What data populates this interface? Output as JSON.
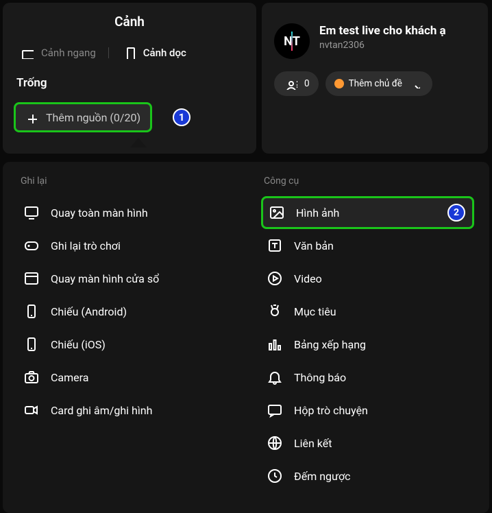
{
  "leftPanel": {
    "title": "Cảnh",
    "tabs": {
      "horizontal": "Cảnh ngang",
      "vertical": "Cảnh dọc"
    },
    "emptyLabel": "Trống",
    "addSource": "Thêm nguồn (0/20)",
    "calloutNumber": "1"
  },
  "rightPanel": {
    "avatarText": "NT",
    "title": "Em test live cho khách ạ",
    "username": "nvtan2306",
    "viewerCount": "0",
    "addTopic": "Thêm chủ đề"
  },
  "dropdown": {
    "col1Title": "Ghi lại",
    "col2Title": "Công cụ",
    "capture": [
      {
        "label": "Quay toàn màn hình",
        "icon": "monitor"
      },
      {
        "label": "Ghi lại trò chơi",
        "icon": "gamepad"
      },
      {
        "label": "Quay màn hình cửa sổ",
        "icon": "window"
      },
      {
        "label": "Chiếu (Android)",
        "icon": "phone"
      },
      {
        "label": "Chiếu (iOS)",
        "icon": "phone"
      },
      {
        "label": "Camera",
        "icon": "camera"
      },
      {
        "label": "Card ghi âm/ghi hình",
        "icon": "camcorder"
      }
    ],
    "tools": [
      {
        "label": "Hình ảnh",
        "icon": "image",
        "highlighted": true,
        "badge": "2"
      },
      {
        "label": "Văn bản",
        "icon": "text"
      },
      {
        "label": "Video",
        "icon": "play"
      },
      {
        "label": "Mục tiêu",
        "icon": "medal"
      },
      {
        "label": "Bảng xếp hạng",
        "icon": "chart"
      },
      {
        "label": "Thông báo",
        "icon": "bell"
      },
      {
        "label": "Hộp trò chuyện",
        "icon": "chat"
      },
      {
        "label": "Liên kết",
        "icon": "globe"
      },
      {
        "label": "Đếm ngược",
        "icon": "clock"
      }
    ]
  }
}
